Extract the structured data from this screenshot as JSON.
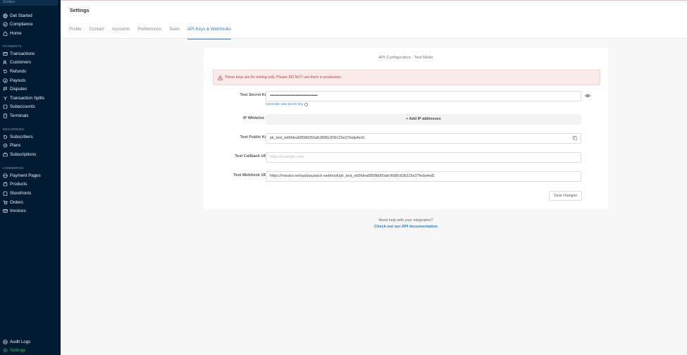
{
  "sidebar": {
    "brand": "Zeoboo",
    "top_items": [
      {
        "label": "Get Started",
        "icon": "globe-icon"
      },
      {
        "label": "Compliance",
        "icon": "compliance-icon"
      },
      {
        "label": "Home",
        "icon": "home-icon"
      }
    ],
    "sections": [
      {
        "title": "PAYMENTS",
        "items": [
          {
            "label": "Transactions",
            "icon": "transactions-icon"
          },
          {
            "label": "Customers",
            "icon": "customers-icon"
          },
          {
            "label": "Refunds",
            "icon": "refunds-icon"
          },
          {
            "label": "Payouts",
            "icon": "payouts-icon"
          },
          {
            "label": "Disputes",
            "icon": "disputes-icon"
          },
          {
            "label": "Transaction Splits",
            "icon": "splits-icon"
          },
          {
            "label": "Subaccounts",
            "icon": "subaccounts-icon"
          },
          {
            "label": "Terminals",
            "icon": "terminals-icon"
          }
        ]
      },
      {
        "title": "RECURRING",
        "items": [
          {
            "label": "Subscribers",
            "icon": "subscribers-icon"
          },
          {
            "label": "Plans",
            "icon": "plans-icon"
          },
          {
            "label": "Subscriptions",
            "icon": "subscriptions-icon"
          }
        ]
      },
      {
        "title": "COMMERCE",
        "items": [
          {
            "label": "Payment Pages",
            "icon": "payment-pages-icon"
          },
          {
            "label": "Products",
            "icon": "products-icon"
          },
          {
            "label": "Storefronts",
            "icon": "storefronts-icon"
          },
          {
            "label": "Orders",
            "icon": "orders-icon"
          },
          {
            "label": "Invoices",
            "icon": "invoices-icon"
          }
        ]
      }
    ],
    "bottom_items": [
      {
        "label": "Audit Logs",
        "icon": "audit-logs-icon"
      },
      {
        "label": "Settings",
        "icon": "gear-icon",
        "active": true
      }
    ]
  },
  "header": {
    "title": "Settings",
    "tabs": [
      {
        "label": "Profile"
      },
      {
        "label": "Contact"
      },
      {
        "label": "Accounts"
      },
      {
        "label": "Preferences"
      },
      {
        "label": "Team"
      },
      {
        "label": "API Keys & Webhooks",
        "active": true
      }
    ]
  },
  "card": {
    "title": "API Configuration - Test Mode",
    "alert": "These keys are for testing only. Please DO NOT use them in production.",
    "secret_key": {
      "label": "Test Secret Key",
      "value": "••••••••••••••••••••••••••••••••••••••••••••••••••",
      "generate_link": "Generate new secret key"
    },
    "ip_whitelist": {
      "label": "IP Whitelist",
      "button": "+ Add IP addresses"
    },
    "public_key": {
      "label": "Test Public Key",
      "value": "pk_test_eb5fdea5858b050afc9686c83b115e37feda4ed1"
    },
    "callback_url": {
      "label": "Test Callback URL",
      "placeholder": "https://example.com"
    },
    "webhook_url": {
      "label": "Test Webhook URL",
      "value": "https://miestro.net/api/paystack-webhook/pk_test_eb5fdea5858b050afc9686c83b115e37feda4ed1"
    },
    "save_button": "Save changes"
  },
  "help": {
    "text": "Need help with your integration?",
    "link": "Check out our API documentation"
  },
  "colors": {
    "sidebar_bg": "#011b33",
    "accent": "#2d7fd3",
    "active_nav": "#3bb75e",
    "alert_text": "#c2404b",
    "alert_bg": "#fbeaea"
  }
}
